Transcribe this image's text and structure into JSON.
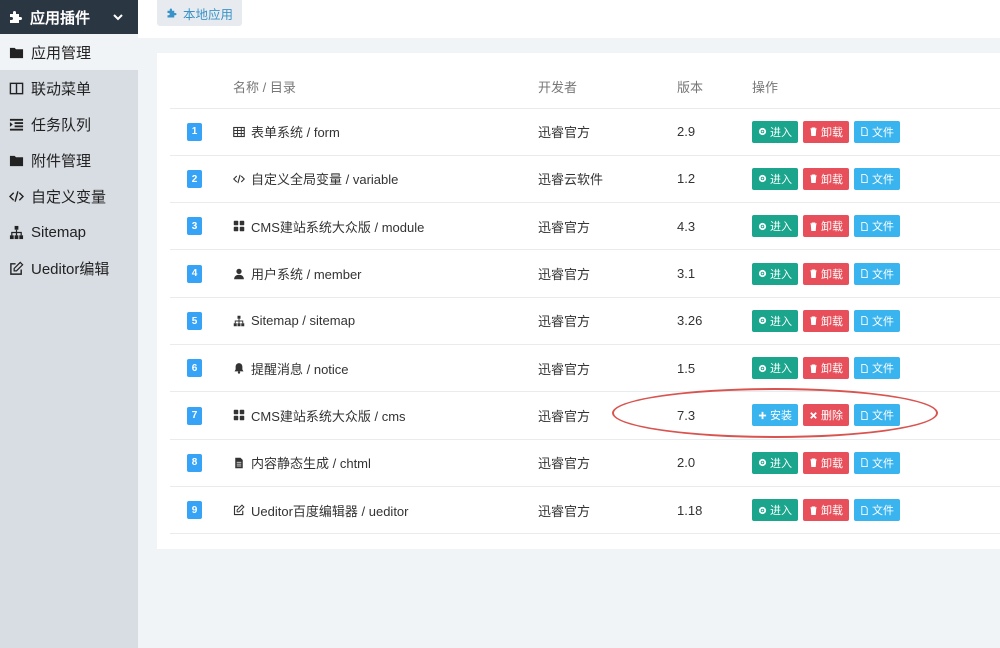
{
  "sidebar": {
    "header": {
      "label": "应用插件",
      "icon": "puzzle-icon"
    },
    "items": [
      {
        "label": "应用管理",
        "icon": "folder-icon",
        "active": true
      },
      {
        "label": "联动菜单",
        "icon": "columns-icon"
      },
      {
        "label": "任务队列",
        "icon": "indent-icon"
      },
      {
        "label": "附件管理",
        "icon": "folder-icon"
      },
      {
        "label": "自定义变量",
        "icon": "code-icon"
      },
      {
        "label": "Sitemap",
        "icon": "sitemap-icon"
      },
      {
        "label": "Ueditor编辑",
        "icon": "edit-icon"
      }
    ]
  },
  "topbar": {
    "tab_label": "本地应用"
  },
  "table": {
    "headers": {
      "name": "名称 / 目录",
      "developer": "开发者",
      "version": "版本",
      "actions": "操作"
    },
    "rows": [
      {
        "idx": "1",
        "icon": "table-icon",
        "name": "表单系统 / form",
        "developer": "迅睿官方",
        "version": "2.9",
        "installed": true
      },
      {
        "idx": "2",
        "icon": "code-icon",
        "name": "自定义全局变量 / variable",
        "developer": "迅睿云软件",
        "version": "1.2",
        "installed": true
      },
      {
        "idx": "3",
        "icon": "grid-icon",
        "name": "CMS建站系统大众版 / module",
        "developer": "迅睿官方",
        "version": "4.3",
        "installed": true
      },
      {
        "idx": "4",
        "icon": "user-icon",
        "name": "用户系统 / member",
        "developer": "迅睿官方",
        "version": "3.1",
        "installed": true
      },
      {
        "idx": "5",
        "icon": "sitemap-icon",
        "name": "Sitemap / sitemap",
        "developer": "迅睿官方",
        "version": "3.26",
        "installed": true
      },
      {
        "idx": "6",
        "icon": "bell-icon",
        "name": "提醒消息 / notice",
        "developer": "迅睿官方",
        "version": "1.5",
        "installed": true
      },
      {
        "idx": "7",
        "icon": "grid-icon",
        "name": "CMS建站系统大众版 / cms",
        "developer": "迅睿官方",
        "version": "7.3",
        "installed": false
      },
      {
        "idx": "8",
        "icon": "file-icon",
        "name": "内容静态生成 / chtml",
        "developer": "迅睿官方",
        "version": "2.0",
        "installed": true
      },
      {
        "idx": "9",
        "icon": "edit-icon",
        "name": "Ueditor百度编辑器 / ueditor",
        "developer": "迅睿官方",
        "version": "1.18",
        "installed": true
      }
    ],
    "buttons": {
      "enter": "进入",
      "uninstall": "卸载",
      "files": "文件",
      "install": "安装",
      "delete": "删除"
    }
  },
  "colors": {
    "green": "#1aa58c",
    "red": "#e7505a",
    "blue": "#3ab4ee",
    "badge": "#36a3f7",
    "annotation": "#d9534f"
  }
}
